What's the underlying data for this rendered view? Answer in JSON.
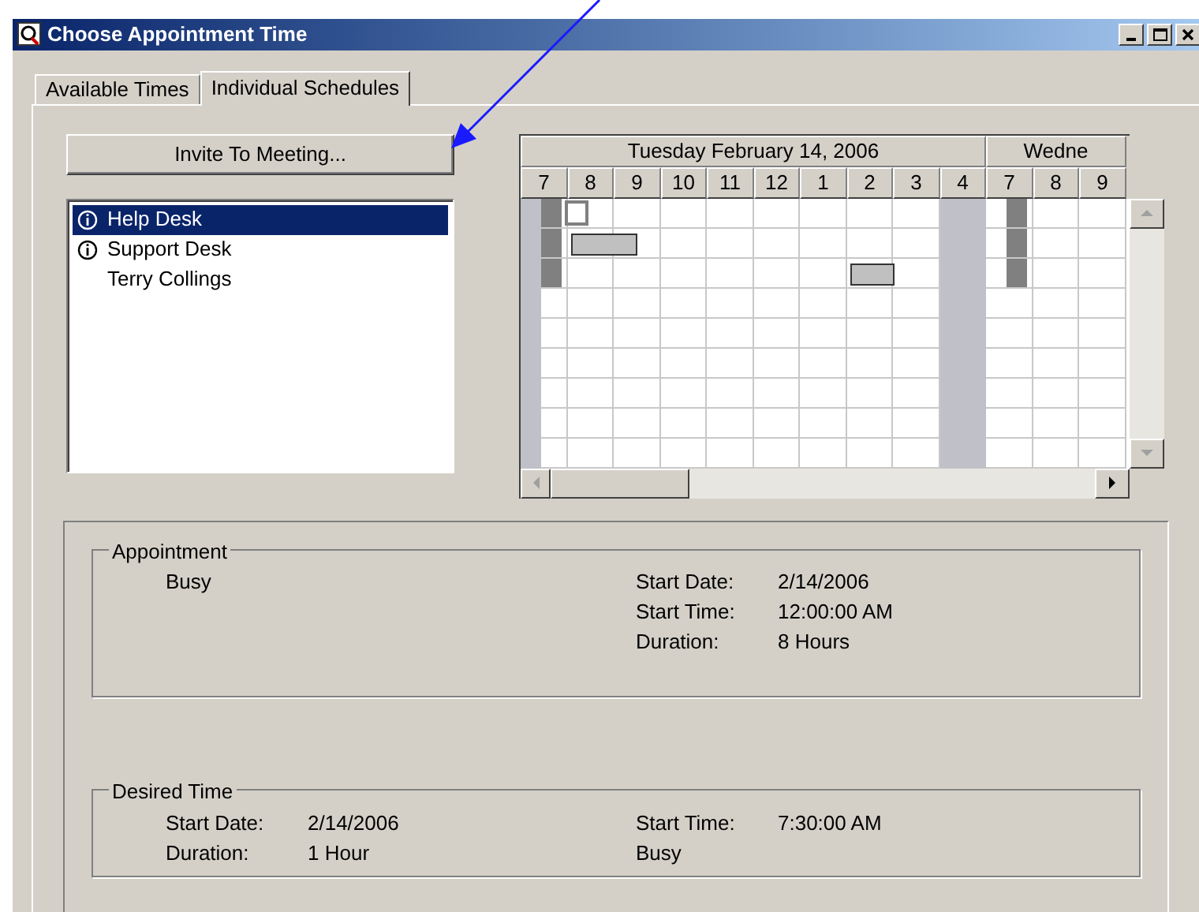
{
  "window": {
    "title": "Choose Appointment Time"
  },
  "tabs": [
    {
      "label": "Available Times",
      "selected": false
    },
    {
      "label": "Individual Schedules",
      "selected": true
    }
  ],
  "invite_button": "Invite To Meeting...",
  "attendees": [
    {
      "name": "Help Desk",
      "info": true,
      "selected": true
    },
    {
      "name": "Support Desk",
      "info": true,
      "selected": false
    },
    {
      "name": "Terry Collings",
      "info": false,
      "selected": false
    }
  ],
  "schedule": {
    "days": [
      {
        "label": "Tuesday February 14, 2006",
        "hours": [
          {
            "label": "7",
            "kind": "start"
          },
          {
            "label": "8",
            "kind": "work"
          },
          {
            "label": "9",
            "kind": "work"
          },
          {
            "label": "10",
            "kind": "work"
          },
          {
            "label": "11",
            "kind": "work"
          },
          {
            "label": "12",
            "kind": "work"
          },
          {
            "label": "1",
            "kind": "work"
          },
          {
            "label": "2",
            "kind": "work"
          },
          {
            "label": "3",
            "kind": "work"
          },
          {
            "label": "4",
            "kind": "off"
          }
        ]
      },
      {
        "label": "Wedne",
        "hours": [
          {
            "label": "7",
            "kind": "start"
          },
          {
            "label": "8",
            "kind": "work"
          },
          {
            "label": "9",
            "kind": "work"
          }
        ]
      }
    ]
  },
  "appointment": {
    "title": "Appointment",
    "status": "Busy",
    "fields": [
      {
        "label": "Start Date:",
        "value": "2/14/2006"
      },
      {
        "label": "Start Time:",
        "value": "12:00:00 AM"
      },
      {
        "label": "Duration:",
        "value": "8 Hours"
      }
    ]
  },
  "desired_time": {
    "title": "Desired Time",
    "left_fields": [
      {
        "label": "Start Date:",
        "value": "2/14/2006"
      },
      {
        "label": "Duration:",
        "value": "1 Hour"
      }
    ],
    "start_time": {
      "label": "Start Time:",
      "value": "7:30:00 AM"
    },
    "status": "Busy"
  }
}
